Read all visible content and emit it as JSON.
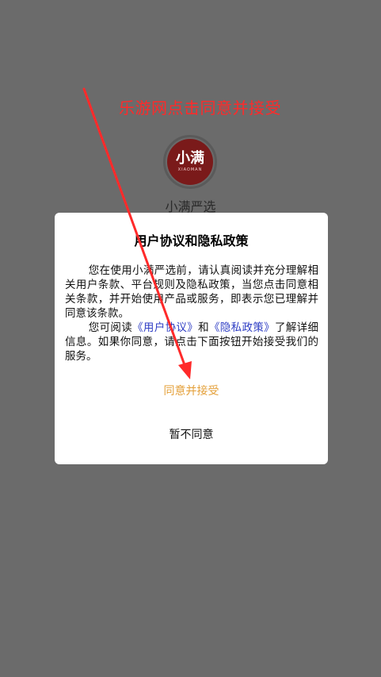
{
  "annotation": {
    "text": "乐游网点击同意并接受",
    "color": "#ff2a2a"
  },
  "app": {
    "logo_text": "小满",
    "logo_subtext": "XIAOMAN",
    "name": "小满严选"
  },
  "dialog": {
    "title": "用户协议和隐私政策",
    "paragraph1": "您在使用小满严选前，请认真阅读并充分理解相关用户条款、平台规则及隐私政策，当您点击同意相关条款，并开始使用产品或服务，即表示您已理解并同意该条款。",
    "paragraph2_prefix": "您可阅读",
    "user_agreement_link": "《用户协议》",
    "paragraph2_and": "和",
    "privacy_policy_link": "《隐私政策》",
    "paragraph2_suffix": "了解详细信息。如果你同意，请点击下面按钮开始接受我们的服务。",
    "agree_button": "同意并接受",
    "decline_button": "暂不同意"
  },
  "colors": {
    "overlay": "#6b6b6b",
    "accent": "#e4a03a",
    "link": "#2f3ec4",
    "logo_bg": "#7a1a1a"
  }
}
